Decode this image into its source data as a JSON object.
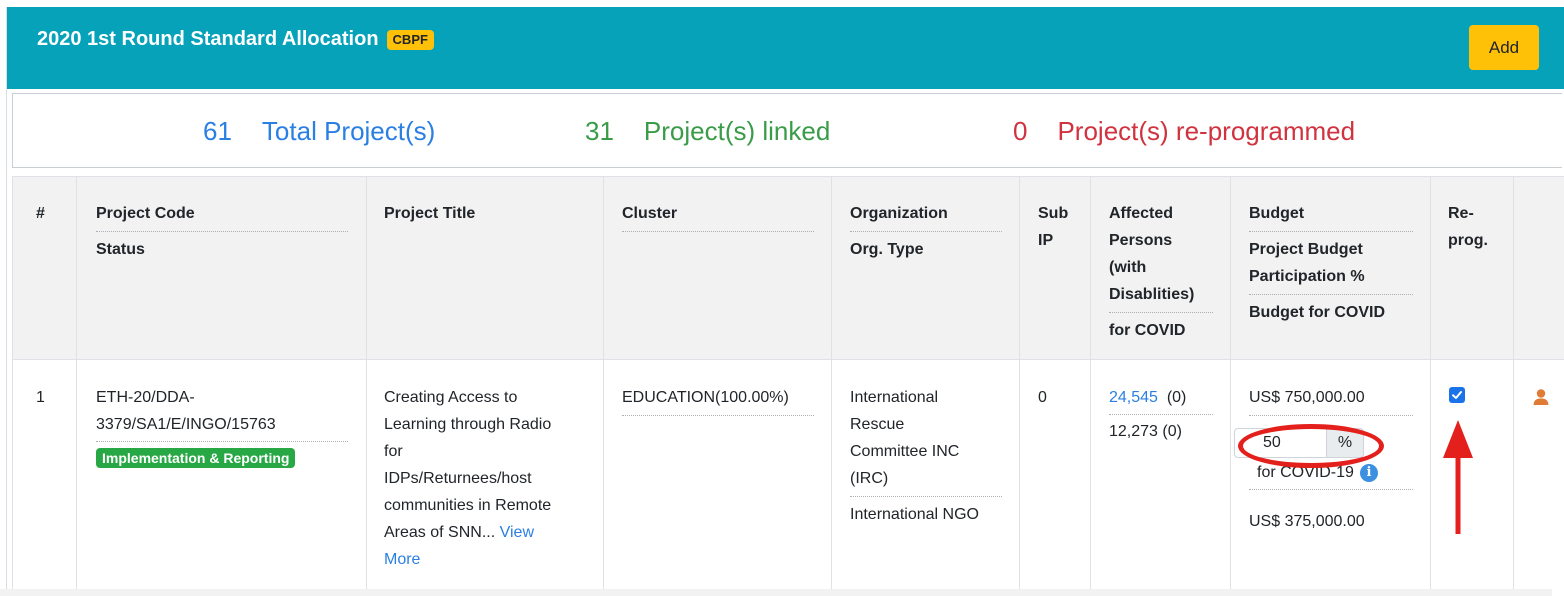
{
  "header": {
    "title": "2020 1st Round Standard Allocation",
    "badge": "CBPF",
    "add_label": "Add"
  },
  "summary": {
    "total_count": "61",
    "total_label": "Total Project(s)",
    "linked_count": "31",
    "linked_label": "Project(s) linked",
    "reprogrammed_count": "0",
    "reprogrammed_label": "Project(s) re-programmed"
  },
  "columns": {
    "num": "#",
    "code": "Project Code",
    "status": "Status",
    "title": "Project Title",
    "cluster": "Cluster",
    "org": "Organization",
    "org_type": "Org. Type",
    "sub_ip_1": "Sub",
    "sub_ip_2": "IP",
    "affected_1": "Affected",
    "affected_2": "Persons",
    "affected_3": "(with",
    "affected_4": "Disablities)",
    "for_covid": "for COVID",
    "budget": "Budget",
    "participation_1": "Project Budget",
    "participation_2": "Participation %",
    "budget_covid": "Budget for COVID",
    "reprog_1": "Re-",
    "reprog_2": "prog."
  },
  "row": {
    "num": "1",
    "code_1": "ETH-20/DDA-",
    "code_2": "3379/SA1/E/INGO/15763",
    "status": "Implementation & Reporting",
    "title_lines": [
      "Creating Access to",
      "Learning through Radio",
      "for",
      "IDPs/Returnees/host",
      "communities in Remote",
      "Areas of SNN..."
    ],
    "view_more_1": "View",
    "view_more_2": "More",
    "cluster": "EDUCATION(100.00%)",
    "org_lines": [
      "International",
      "Rescue",
      "Committee INC",
      "(IRC)"
    ],
    "org_type": "International NGO",
    "sub_ip": "0",
    "affected": "24,545",
    "affected_dis": "(0)",
    "covid_affected": "12,273 (0)",
    "budget": "US$ 750,000.00",
    "participation": "50",
    "pct_symbol": "%",
    "covid_label": "for COVID-19",
    "budget_covid": "US$ 375,000.00",
    "reprog_checked": true
  },
  "colors": {
    "header_bg": "#05a2b9",
    "accent": "#ffc107",
    "blue": "#2a7fe3",
    "green": "#3a9c48",
    "red": "#d0333f",
    "annotation": "#e3201b"
  },
  "icons": [
    "info-icon",
    "user-icon",
    "checkbox-icon",
    "annotation-arrow"
  ]
}
